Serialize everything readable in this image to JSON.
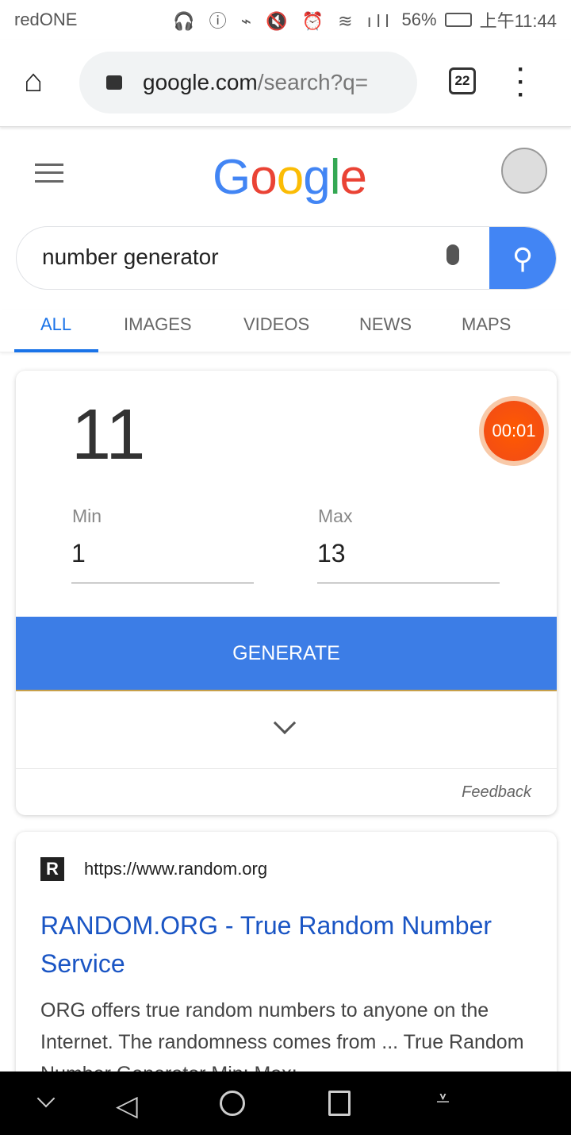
{
  "status": {
    "carrier": "redONE",
    "battery": "56%",
    "time": "上午11:44"
  },
  "browser": {
    "url_domain": "google.com",
    "url_path": "/search?q=",
    "tab_count": "22"
  },
  "search": {
    "query": "number generator",
    "tabs": [
      "ALL",
      "IMAGES",
      "VIDEOS",
      "NEWS",
      "MAPS"
    ],
    "active_tab": "ALL"
  },
  "rng": {
    "result": "11",
    "timer": "00:01",
    "min_label": "Min",
    "min_value": "1",
    "max_label": "Max",
    "max_value": "13",
    "generate_label": "GENERATE",
    "feedback": "Feedback"
  },
  "result1": {
    "url": "https://www.random.org",
    "favicon": "R",
    "title": "RANDOM.ORG - True Random Number Service",
    "snippet": "ORG offers true random numbers to anyone on the Internet. The randomness comes from ... True Random Number Generator Min: Max:"
  },
  "colors": {
    "accent": "#1a73e8",
    "button": "#3c7de6",
    "link": "#1a0dab"
  }
}
